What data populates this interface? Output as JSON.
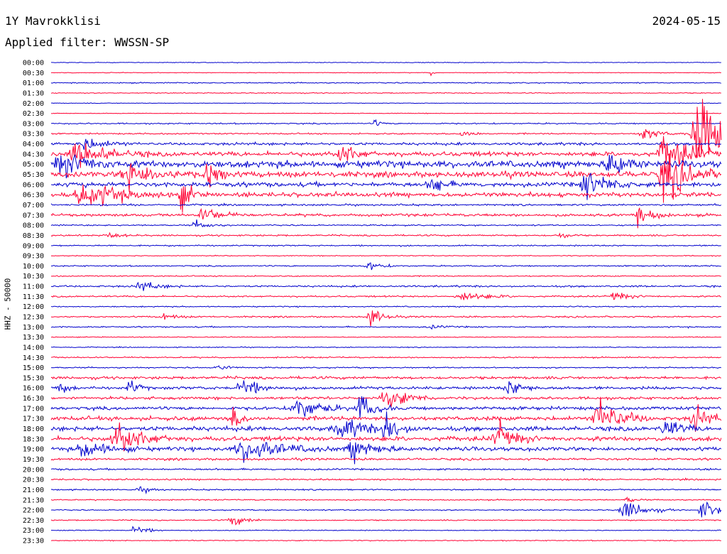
{
  "header": {
    "station": "1Y Mavrokklisi",
    "date": "2024-05-15",
    "filter": "Applied filter: WWSSN-SP"
  },
  "chart_data": {
    "type": "line",
    "title": "1Y Mavrokklisi",
    "date": "2024-05-15",
    "filter": "WWSSN-SP",
    "ylabel": "HHZ - 50000",
    "trace_colors": [
      "#0000cc",
      "#ff0033"
    ],
    "row_labels": [
      "00:00",
      "00:30",
      "01:00",
      "01:30",
      "02:00",
      "02:30",
      "03:00",
      "03:30",
      "04:00",
      "04:30",
      "05:00",
      "05:30",
      "06:00",
      "06:30",
      "07:00",
      "07:30",
      "08:00",
      "08:30",
      "09:00",
      "09:30",
      "10:00",
      "10:30",
      "11:00",
      "11:30",
      "12:00",
      "12:30",
      "13:00",
      "13:30",
      "14:00",
      "14:30",
      "15:00",
      "15:30",
      "16:00",
      "16:30",
      "17:00",
      "17:30",
      "18:00",
      "18:30",
      "19:00",
      "19:30",
      "20:00",
      "20:30",
      "21:00",
      "21:30",
      "22:00",
      "22:30",
      "23:00",
      "23:30"
    ],
    "x_minutes": [
      0,
      30
    ],
    "noise_level": [
      0.3,
      0.3,
      0.5,
      0.4,
      0.3,
      0.3,
      0.6,
      0.6,
      1.2,
      2.0,
      3.0,
      2.5,
      2.0,
      2.0,
      0.8,
      1.2,
      0.6,
      0.7,
      0.6,
      0.4,
      0.6,
      0.5,
      0.8,
      0.7,
      0.5,
      0.7,
      0.6,
      0.4,
      0.4,
      0.6,
      0.6,
      1.2,
      1.3,
      1.2,
      1.5,
      1.8,
      2.0,
      2.0,
      1.8,
      1.0,
      0.8,
      0.7,
      0.6,
      0.5,
      0.5,
      0.5,
      0.4,
      0.4
    ],
    "events": [
      {
        "row": "00:30",
        "minute": 17.0,
        "amplitude": 2,
        "duration_min": 0.2
      },
      {
        "row": "03:00",
        "minute": 14.5,
        "amplitude": 4,
        "duration_min": 0.4
      },
      {
        "row": "03:30",
        "minute": 18.4,
        "amplitude": 5,
        "duration_min": 0.8
      },
      {
        "row": "03:30",
        "minute": 26.5,
        "amplitude": 6,
        "duration_min": 1.2
      },
      {
        "row": "03:30",
        "minute": 29.0,
        "amplitude": 40,
        "duration_min": 1.8
      },
      {
        "row": "04:00",
        "minute": 1.5,
        "amplitude": 6,
        "duration_min": 1.5
      },
      {
        "row": "04:30",
        "minute": 1.2,
        "amplitude": 12,
        "duration_min": 2.0
      },
      {
        "row": "04:30",
        "minute": 13.0,
        "amplitude": 10,
        "duration_min": 1.0
      },
      {
        "row": "04:30",
        "minute": 27.5,
        "amplitude": 22,
        "duration_min": 1.6
      },
      {
        "row": "05:00",
        "minute": 0.5,
        "amplitude": 12,
        "duration_min": 1.8
      },
      {
        "row": "05:00",
        "minute": 25.0,
        "amplitude": 14,
        "duration_min": 1.0
      },
      {
        "row": "05:30",
        "minute": 3.5,
        "amplitude": 12,
        "duration_min": 2.0
      },
      {
        "row": "05:30",
        "minute": 7.0,
        "amplitude": 16,
        "duration_min": 0.8
      },
      {
        "row": "05:30",
        "minute": 27.5,
        "amplitude": 25,
        "duration_min": 1.5
      },
      {
        "row": "06:00",
        "minute": 17.0,
        "amplitude": 10,
        "duration_min": 0.8
      },
      {
        "row": "06:00",
        "minute": 24.0,
        "amplitude": 14,
        "duration_min": 1.5
      },
      {
        "row": "06:30",
        "minute": 1.5,
        "amplitude": 12,
        "duration_min": 2.5
      },
      {
        "row": "06:30",
        "minute": 5.8,
        "amplitude": 18,
        "duration_min": 0.6
      },
      {
        "row": "07:30",
        "minute": 6.8,
        "amplitude": 8,
        "duration_min": 1.2
      },
      {
        "row": "07:30",
        "minute": 26.2,
        "amplitude": 9,
        "duration_min": 1.2
      },
      {
        "row": "08:00",
        "minute": 6.5,
        "amplitude": 4,
        "duration_min": 1.0
      },
      {
        "row": "08:30",
        "minute": 2.6,
        "amplitude": 3,
        "duration_min": 0.8
      },
      {
        "row": "08:30",
        "minute": 22.8,
        "amplitude": 4,
        "duration_min": 0.6
      },
      {
        "row": "10:00",
        "minute": 14.2,
        "amplitude": 4,
        "duration_min": 1.0
      },
      {
        "row": "11:00",
        "minute": 4.0,
        "amplitude": 5,
        "duration_min": 1.2
      },
      {
        "row": "11:30",
        "minute": 18.4,
        "amplitude": 5,
        "duration_min": 1.6
      },
      {
        "row": "11:30",
        "minute": 25.2,
        "amplitude": 5,
        "duration_min": 1.0
      },
      {
        "row": "12:30",
        "minute": 5.0,
        "amplitude": 4,
        "duration_min": 0.8
      },
      {
        "row": "12:30",
        "minute": 14.3,
        "amplitude": 10,
        "duration_min": 0.8
      },
      {
        "row": "13:00",
        "minute": 17.0,
        "amplitude": 2,
        "duration_min": 1.0
      },
      {
        "row": "15:00",
        "minute": 7.5,
        "amplitude": 3,
        "duration_min": 0.8
      },
      {
        "row": "16:00",
        "minute": 0.3,
        "amplitude": 6,
        "duration_min": 0.6
      },
      {
        "row": "16:00",
        "minute": 3.5,
        "amplitude": 8,
        "duration_min": 0.6
      },
      {
        "row": "16:00",
        "minute": 8.5,
        "amplitude": 10,
        "duration_min": 1.2
      },
      {
        "row": "16:00",
        "minute": 20.5,
        "amplitude": 7,
        "duration_min": 1.2
      },
      {
        "row": "16:30",
        "minute": 15.0,
        "amplitude": 10,
        "duration_min": 1.5
      },
      {
        "row": "17:00",
        "minute": 11.0,
        "amplitude": 12,
        "duration_min": 1.5
      },
      {
        "row": "17:00",
        "minute": 13.8,
        "amplitude": 14,
        "duration_min": 1.0
      },
      {
        "row": "17:30",
        "minute": 8.1,
        "amplitude": 10,
        "duration_min": 0.8
      },
      {
        "row": "17:30",
        "minute": 24.5,
        "amplitude": 20,
        "duration_min": 1.5
      },
      {
        "row": "17:30",
        "minute": 28.8,
        "amplitude": 12,
        "duration_min": 1.0
      },
      {
        "row": "18:00",
        "minute": 13.0,
        "amplitude": 12,
        "duration_min": 1.5
      },
      {
        "row": "18:00",
        "minute": 15.0,
        "amplitude": 14,
        "duration_min": 1.0
      },
      {
        "row": "18:00",
        "minute": 27.5,
        "amplitude": 10,
        "duration_min": 1.0
      },
      {
        "row": "18:30",
        "minute": 3.0,
        "amplitude": 14,
        "duration_min": 1.8
      },
      {
        "row": "18:30",
        "minute": 20.0,
        "amplitude": 14,
        "duration_min": 1.2
      },
      {
        "row": "19:00",
        "minute": 1.5,
        "amplitude": 10,
        "duration_min": 1.5
      },
      {
        "row": "19:00",
        "minute": 8.7,
        "amplitude": 12,
        "duration_min": 2.5
      },
      {
        "row": "19:00",
        "minute": 13.5,
        "amplitude": 10,
        "duration_min": 1.5
      },
      {
        "row": "21:00",
        "minute": 4.0,
        "amplitude": 3,
        "duration_min": 0.8
      },
      {
        "row": "21:30",
        "minute": 25.8,
        "amplitude": 3,
        "duration_min": 0.6
      },
      {
        "row": "22:00",
        "minute": 25.7,
        "amplitude": 10,
        "duration_min": 1.4
      },
      {
        "row": "22:00",
        "minute": 29.2,
        "amplitude": 10,
        "duration_min": 1.2
      },
      {
        "row": "22:30",
        "minute": 8.1,
        "amplitude": 6,
        "duration_min": 1.0
      },
      {
        "row": "23:00",
        "minute": 3.7,
        "amplitude": 6,
        "duration_min": 0.8
      }
    ]
  }
}
